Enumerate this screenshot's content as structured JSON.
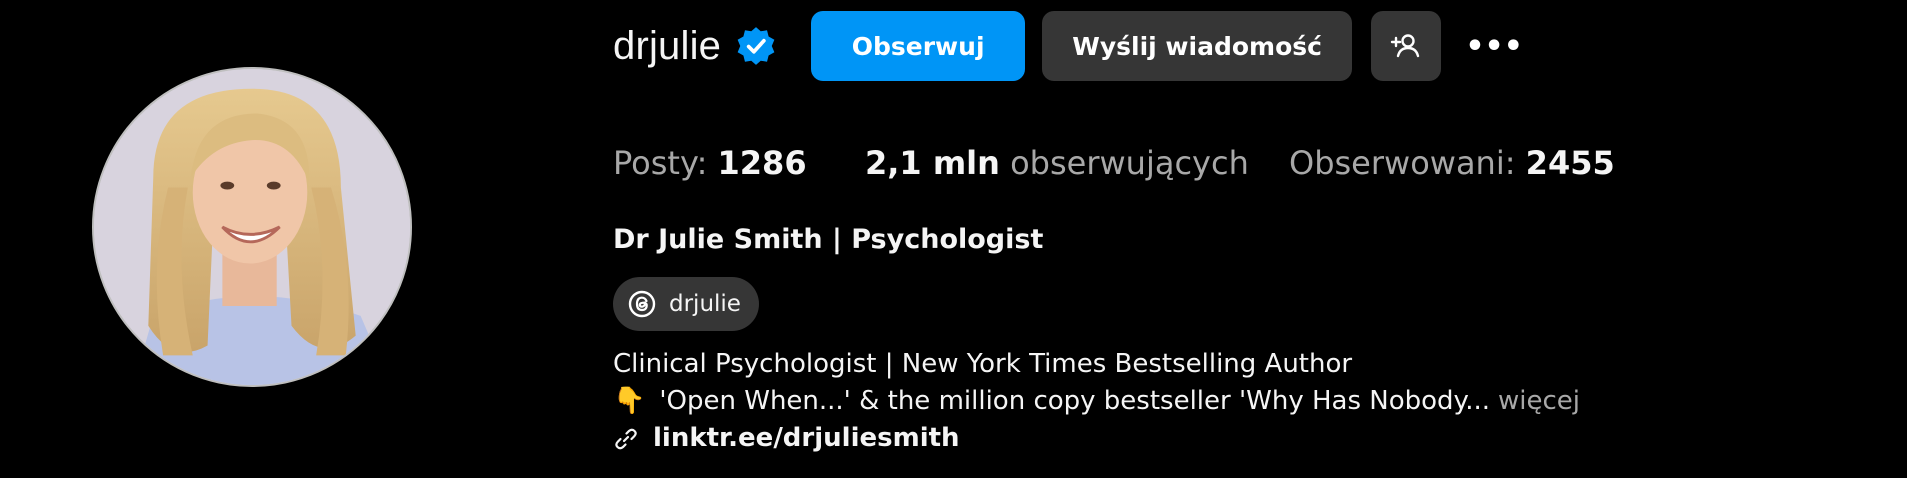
{
  "profile": {
    "username": "drjulie",
    "verified": true,
    "full_name": "Dr Julie Smith | Psychologist",
    "threads_handle": "drjulie"
  },
  "actions": {
    "follow_label": "Obserwuj",
    "message_label": "Wyślij wiadomość",
    "more_label": "•••"
  },
  "stats": {
    "posts_label": "Posty:",
    "posts_count": "1286",
    "followers_count": "2,1 mln",
    "followers_label": "obserwujących",
    "following_label": "Obserwowani:",
    "following_count": "2455"
  },
  "bio": {
    "line1": "Clinical Psychologist | New York Times Bestselling Author",
    "line2_emoji": "👇",
    "line2_text": "'Open When...' & the million copy bestseller 'Why Has Nobody...",
    "more_label": "więcej",
    "link": "linktr.ee/drjuliesmith"
  },
  "colors": {
    "background": "#000000",
    "primary_button": "#0095f6",
    "secondary_button": "#363636",
    "muted_text": "#a8a8a8",
    "verified_badge": "#0095f6"
  },
  "icons": {
    "verified": "verified-badge-icon",
    "suggest": "person-add-icon",
    "threads": "threads-icon",
    "link": "link-icon"
  }
}
